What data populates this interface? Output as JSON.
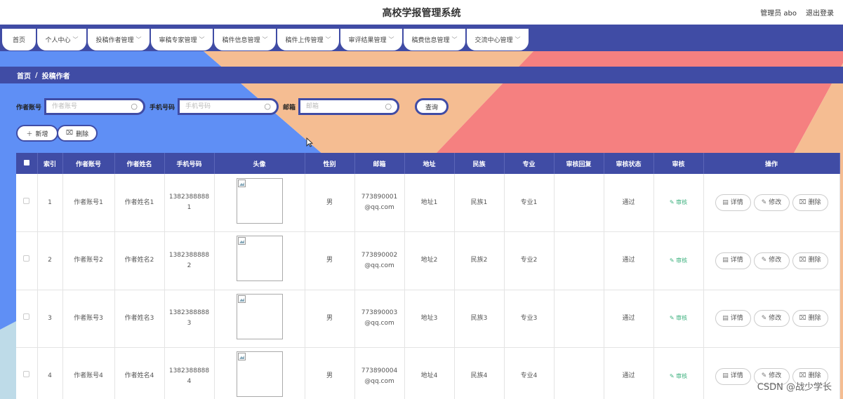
{
  "header": {
    "title": "高校学报管理系统",
    "admin": "管理员 abo",
    "logout": "退出登录"
  },
  "nav": {
    "tabs": [
      {
        "label": "首页",
        "dropdown": false
      },
      {
        "label": "个人中心",
        "dropdown": true
      },
      {
        "label": "投稿作者管理",
        "dropdown": true
      },
      {
        "label": "审稿专家管理",
        "dropdown": true
      },
      {
        "label": "稿件信息管理",
        "dropdown": true
      },
      {
        "label": "稿件上传管理",
        "dropdown": true
      },
      {
        "label": "审评结果管理",
        "dropdown": true
      },
      {
        "label": "稿费信息管理",
        "dropdown": true
      },
      {
        "label": "交流中心管理",
        "dropdown": true
      }
    ]
  },
  "breadcrumb": {
    "home": "首页",
    "separator": "/",
    "current": "投稿作者"
  },
  "search": {
    "account_label": "作者账号",
    "account_placeholder": "作者账号",
    "phone_label": "手机号码",
    "phone_placeholder": "手机号码",
    "email_label": "邮箱",
    "email_placeholder": "邮箱",
    "query_label": "查询"
  },
  "actions": {
    "add_label": "新增",
    "delete_label": "删除"
  },
  "table": {
    "columns": [
      "索引",
      "作者账号",
      "作者姓名",
      "手机号码",
      "头像",
      "性别",
      "邮箱",
      "地址",
      "民族",
      "专业",
      "审核回复",
      "审核状态",
      "审核",
      "操作"
    ],
    "audit_link": "审核",
    "detail_label": "详情",
    "edit_label": "修改",
    "delete_label": "删除",
    "rows": [
      {
        "index": "1",
        "account": "作者账号1",
        "name": "作者姓名1",
        "phone_a": "1382388888",
        "phone_b": "1",
        "gender": "男",
        "email_a": "773890001",
        "email_b": "@qq.com",
        "address": "地址1",
        "ethnicity": "民族1",
        "major": "专业1",
        "reply": "",
        "status": "通过"
      },
      {
        "index": "2",
        "account": "作者账号2",
        "name": "作者姓名2",
        "phone_a": "1382388888",
        "phone_b": "2",
        "gender": "男",
        "email_a": "773890002",
        "email_b": "@qq.com",
        "address": "地址2",
        "ethnicity": "民族2",
        "major": "专业2",
        "reply": "",
        "status": "通过"
      },
      {
        "index": "3",
        "account": "作者账号3",
        "name": "作者姓名3",
        "phone_a": "1382388888",
        "phone_b": "3",
        "gender": "男",
        "email_a": "773890003",
        "email_b": "@qq.com",
        "address": "地址3",
        "ethnicity": "民族3",
        "major": "专业3",
        "reply": "",
        "status": "通过"
      },
      {
        "index": "4",
        "account": "作者账号4",
        "name": "作者姓名4",
        "phone_a": "1382388888",
        "phone_b": "4",
        "gender": "男",
        "email_a": "773890004",
        "email_b": "@qq.com",
        "address": "地址4",
        "ethnicity": "民族4",
        "major": "专业4",
        "reply": "",
        "status": "通过"
      }
    ]
  },
  "watermark": "CSDN @战少学长",
  "colors": {
    "primary": "#404ca5",
    "blue": "#5f8ff5",
    "peach": "#f5bd92",
    "coral": "#f58080",
    "light_blue": "#bedbe8",
    "success": "#3bb07d"
  },
  "icons": {
    "search": "magnifier-icon",
    "add": "plus-icon",
    "delete": "trash-icon",
    "detail": "document-icon",
    "edit": "pencil-icon",
    "chevron": "chevron-down-icon"
  }
}
